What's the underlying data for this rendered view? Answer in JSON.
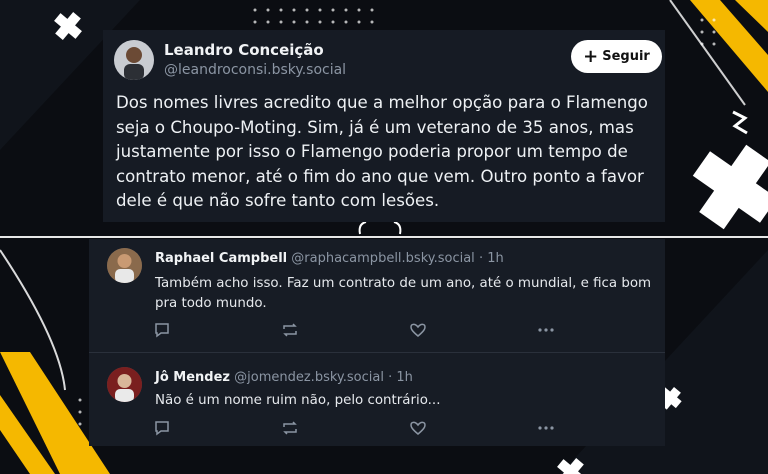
{
  "main_post": {
    "author_name": "Leandro Conceição",
    "author_handle": "@leandroconsi.bsky.social",
    "follow_label": "Seguir",
    "text": "Dos nomes livres acredito que a melhor opção para o Flamengo seja o Choupo-Moting. Sim, já é um veterano de 35 anos, mas justamente por isso o Flamengo poderia propor um tempo de contrato menor, até o fim do ano que vem. Outro ponto a favor dele é que não sofre tanto com lesões."
  },
  "replies": [
    {
      "author_name": "Raphael Campbell",
      "author_handle": "@raphacampbell.bsky.social",
      "time": "· 1h",
      "text": "Também acho isso. Faz um contrato de um ano, até o mundial, e fica bom pra todo mundo."
    },
    {
      "author_name": "Jô Mendez",
      "author_handle": "@jomendez.bsky.social",
      "time": "· 1h",
      "text": "Não é um nome ruim não, pelo contrário..."
    }
  ],
  "icons": [
    "plus-icon",
    "reply-icon",
    "repost-icon",
    "like-icon",
    "more-icon"
  ],
  "colors": {
    "background": "#0b0d12",
    "card": "#161b24",
    "accent_yellow": "#f5b800",
    "handle_gray": "#8b95a3"
  }
}
